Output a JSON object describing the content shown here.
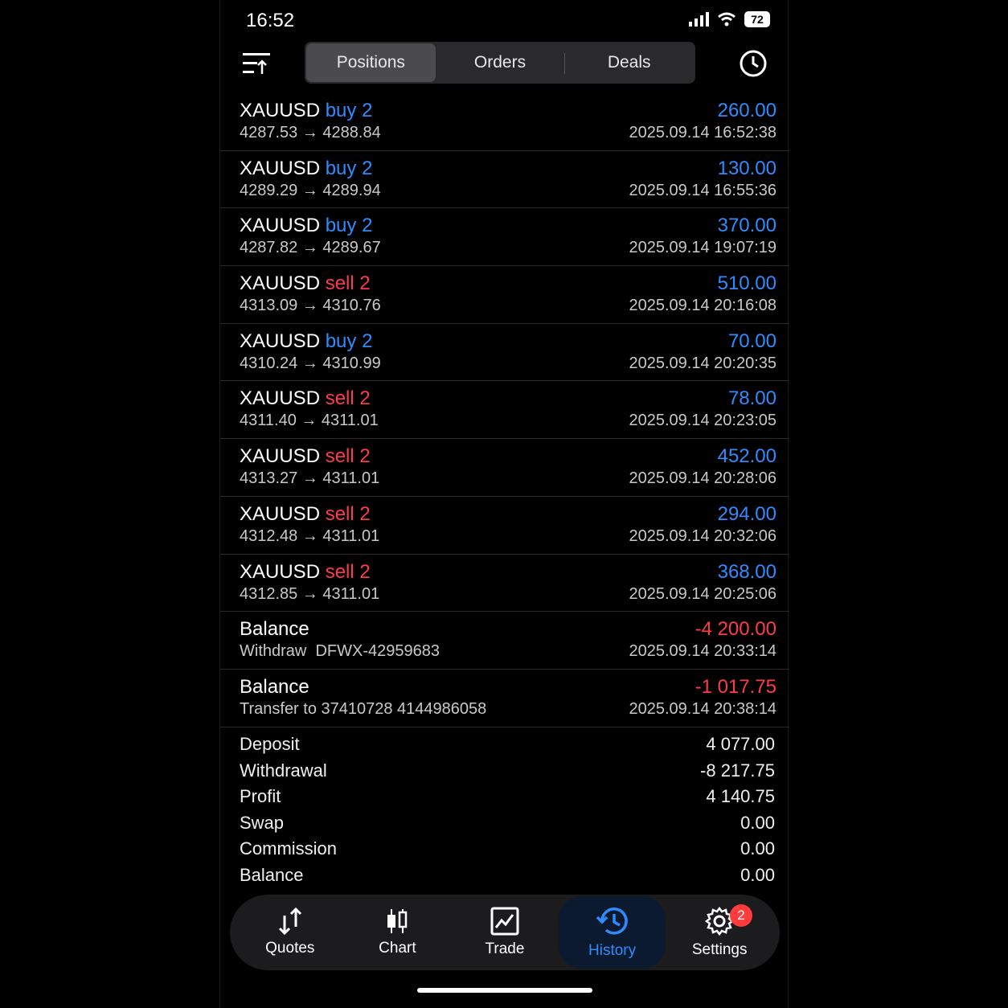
{
  "status": {
    "time": "16:52",
    "battery": "72"
  },
  "segments": [
    {
      "label": "Positions"
    },
    {
      "label": "Orders"
    },
    {
      "label": "Deals"
    }
  ],
  "deals": [
    {
      "symbol": "XAUUSD",
      "side": "buy 2",
      "side_type": "buy",
      "prices": "4287.53 → 4288.84",
      "profit": "260.00",
      "time": "2025.09.14 16:52:38"
    },
    {
      "symbol": "XAUUSD",
      "side": "buy 2",
      "side_type": "buy",
      "prices": "4289.29 → 4289.94",
      "profit": "130.00",
      "time": "2025.09.14 16:55:36"
    },
    {
      "symbol": "XAUUSD",
      "side": "buy 2",
      "side_type": "buy",
      "prices": "4287.82 → 4289.67",
      "profit": "370.00",
      "time": "2025.09.14 19:07:19"
    },
    {
      "symbol": "XAUUSD",
      "side": "sell 2",
      "side_type": "sell",
      "prices": "4313.09 → 4310.76",
      "profit": "510.00",
      "time": "2025.09.14 20:16:08"
    },
    {
      "symbol": "XAUUSD",
      "side": "buy 2",
      "side_type": "buy",
      "prices": "4310.24 → 4310.99",
      "profit": "70.00",
      "time": "2025.09.14 20:20:35"
    },
    {
      "symbol": "XAUUSD",
      "side": "sell 2",
      "side_type": "sell",
      "prices": "4311.40 → 4311.01",
      "profit": "78.00",
      "time": "2025.09.14 20:23:05"
    },
    {
      "symbol": "XAUUSD",
      "side": "sell 2",
      "side_type": "sell",
      "prices": "4313.27 → 4311.01",
      "profit": "452.00",
      "time": "2025.09.14 20:28:06"
    },
    {
      "symbol": "XAUUSD",
      "side": "sell 2",
      "side_type": "sell",
      "prices": "4312.48 → 4311.01",
      "profit": "294.00",
      "time": "2025.09.14 20:32:06"
    },
    {
      "symbol": "XAUUSD",
      "side": "sell 2",
      "side_type": "sell",
      "prices": "4312.85 → 4311.01",
      "profit": "368.00",
      "time": "2025.09.14 20:25:06"
    }
  ],
  "balance_ops": [
    {
      "title": "Balance",
      "comment": "Withdraw  DFWX-42959683",
      "amount": "-4 200.00",
      "time": "2025.09.14 20:33:14"
    },
    {
      "title": "Balance",
      "comment": "Transfer to 37410728 4144986058",
      "amount": "-1 017.75",
      "time": "2025.09.14 20:38:14"
    }
  ],
  "summary": [
    {
      "label": "Deposit",
      "value": "4 077.00"
    },
    {
      "label": "Withdrawal",
      "value": "-8 217.75"
    },
    {
      "label": "Profit",
      "value": "4 140.75"
    },
    {
      "label": "Swap",
      "value": "0.00"
    },
    {
      "label": "Commission",
      "value": "0.00"
    },
    {
      "label": "Balance",
      "value": "0.00"
    }
  ],
  "tabs": [
    {
      "label": "Quotes",
      "icon": "quotes-icon"
    },
    {
      "label": "Chart",
      "icon": "chart-icon"
    },
    {
      "label": "Trade",
      "icon": "trade-icon"
    },
    {
      "label": "History",
      "icon": "history-icon"
    },
    {
      "label": "Settings",
      "icon": "gear-icon",
      "badge": "2"
    }
  ],
  "colors": {
    "buy": "#2f8cff",
    "sell": "#ff3b46",
    "profit": "#2f8cff",
    "loss": "#ff3b46",
    "active_tab": "#2f8cff"
  }
}
